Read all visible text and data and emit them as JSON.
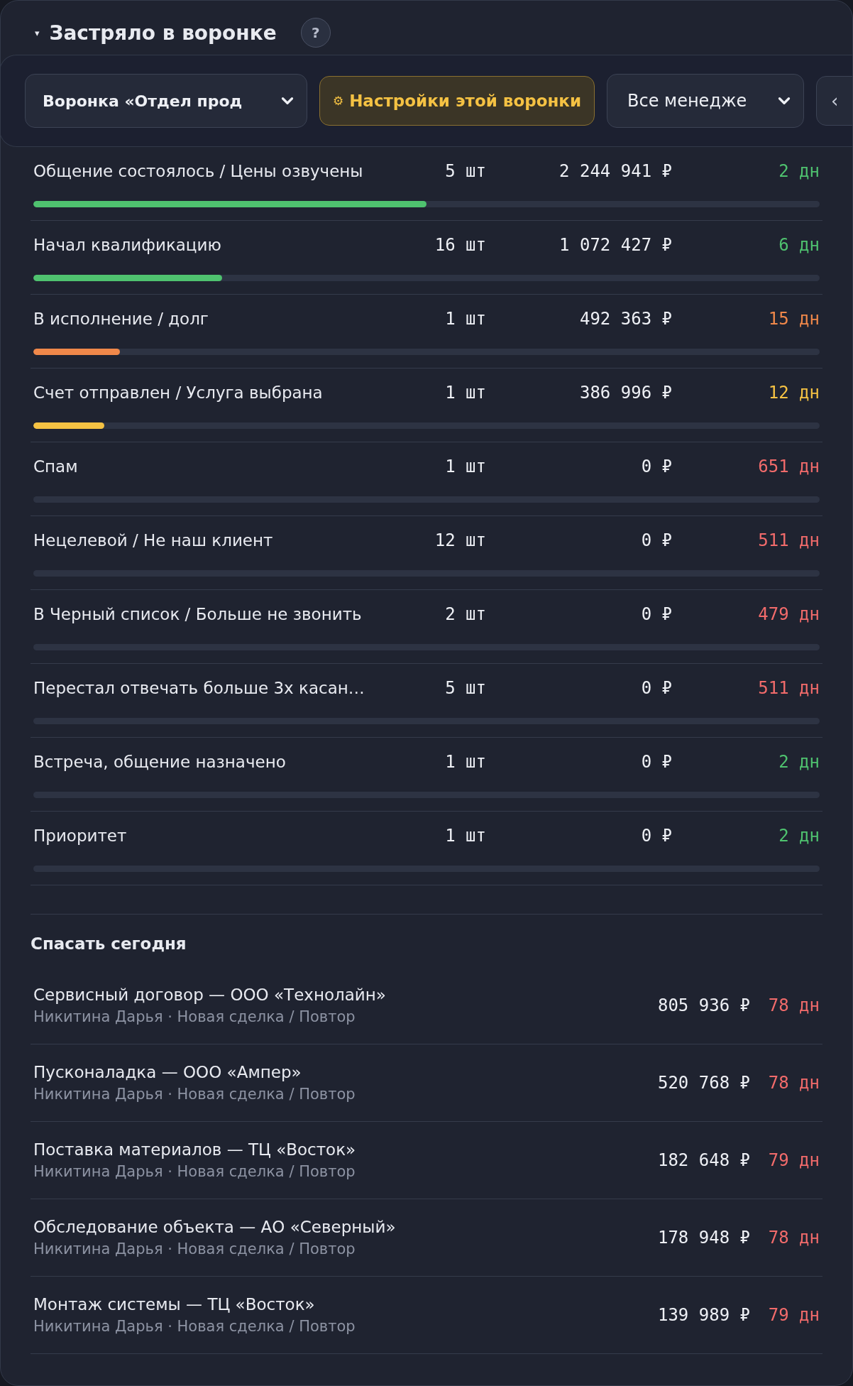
{
  "header": {
    "toggle": "▾",
    "title": "Застряло в воронке",
    "help": "?"
  },
  "toolbar": {
    "funnel_select": "Воронка «Отдел прод",
    "settings_button": {
      "icon": "⚙",
      "label": "Настройки этой воронки"
    },
    "manager_select": "Все менедже",
    "nav_button": "‹"
  },
  "stages": [
    {
      "name": "Общение состоялось / Цены озвучены",
      "count": "5 шт",
      "amount": "2 244 941 ₽",
      "days": "2 дн",
      "color": "#4fc26f",
      "level": 0.5
    },
    {
      "name": "Начал квалификацию",
      "count": "16 шт",
      "amount": "1 072 427 ₽",
      "days": "6 дн",
      "color": "#4fc26f",
      "level": 0.24
    },
    {
      "name": "В исполнение / долг",
      "count": "1 шт",
      "amount": "492 363 ₽",
      "days": "15 дн",
      "color": "#f0884a",
      "level": 0.11
    },
    {
      "name": "Счет отправлен / Услуга выбрана",
      "count": "1 шт",
      "amount": "386 996 ₽",
      "days": "12 дн",
      "color": "#f5c243",
      "level": 0.09
    },
    {
      "name": "Спам",
      "count": "1 шт",
      "amount": "0 ₽",
      "days": "651 дн",
      "color": "#f26b6b"
    },
    {
      "name": "Нецелевой / Не наш клиент",
      "count": "12 шт",
      "amount": "0 ₽",
      "days": "511 дн",
      "color": "#f26b6b"
    },
    {
      "name": "В Черный список / Больше не звонить",
      "count": "2 шт",
      "amount": "0 ₽",
      "days": "479 дн",
      "color": "#f26b6b"
    },
    {
      "name": "Перестал отвечать больше 3х касан…",
      "count": "5 шт",
      "amount": "0 ₽",
      "days": "511 дн",
      "color": "#f26b6b"
    },
    {
      "name": "Встреча, общение назначено",
      "count": "1 шт",
      "amount": "0 ₽",
      "days": "2 дн",
      "color": "#4fc26f"
    },
    {
      "name": "Приоритет",
      "count": "1 шт",
      "amount": "0 ₽",
      "days": "2 дн",
      "color": "#4fc26f"
    }
  ],
  "rescue": {
    "title": "Спасать сегодня",
    "deals": [
      {
        "title": "Сервисный договор — ООО «Технолайн»",
        "subtitle": "Никитина Дарья · Новая сделка / Повтор",
        "amount": "805 936 ₽",
        "days": "78 дн"
      },
      {
        "title": "Пусконаладка — ООО «Ампер»",
        "subtitle": "Никитина Дарья · Новая сделка / Повтор",
        "amount": "520 768 ₽",
        "days": "78 дн"
      },
      {
        "title": "Поставка материалов — ТЦ «Восток»",
        "subtitle": "Никитина Дарья · Новая сделка / Повтор",
        "amount": "182 648 ₽",
        "days": "79 дн"
      },
      {
        "title": "Обследование объекта — АО «Северный»",
        "subtitle": "Никитина Дарья · Новая сделка / Повтор",
        "amount": "178 948 ₽",
        "days": "78 дн"
      },
      {
        "title": "Монтаж системы — ТЦ «Восток»",
        "subtitle": "Никитина Дарья · Новая сделка / Повтор",
        "amount": "139 989 ₽",
        "days": "79 дн"
      }
    ]
  }
}
